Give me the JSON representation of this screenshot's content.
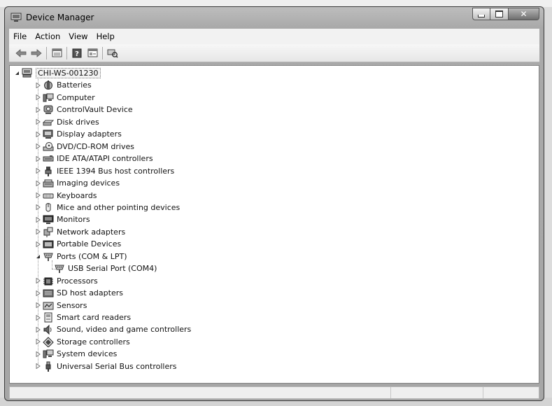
{
  "window": {
    "title": "Device Manager"
  },
  "menu": [
    "File",
    "Action",
    "View",
    "Help"
  ],
  "toolbar": [
    "back-arrow-icon",
    "forward-arrow-icon",
    "properties-icon",
    "help-icon",
    "console-tree-icon",
    "scan-hardware-icon"
  ],
  "tree": {
    "root": "CHI-WS-001230",
    "categories": [
      {
        "label": "Batteries",
        "icon": "battery-icon",
        "expanded": false
      },
      {
        "label": "Computer",
        "icon": "computer-icon",
        "expanded": false
      },
      {
        "label": "ControlVault Device",
        "icon": "controlvault-device-icon",
        "expanded": false
      },
      {
        "label": "Disk drives",
        "icon": "disk-drive-icon",
        "expanded": false
      },
      {
        "label": "Display adapters",
        "icon": "display-adapter-icon",
        "expanded": false
      },
      {
        "label": "DVD/CD-ROM drives",
        "icon": "dvd-drive-icon",
        "expanded": false
      },
      {
        "label": "IDE ATA/ATAPI controllers",
        "icon": "ide-controller-icon",
        "expanded": false
      },
      {
        "label": "IEEE 1394 Bus host controllers",
        "icon": "firewire-plug-icon",
        "expanded": false
      },
      {
        "label": "Imaging devices",
        "icon": "imaging-device-icon",
        "expanded": false
      },
      {
        "label": "Keyboards",
        "icon": "keyboard-icon",
        "expanded": false
      },
      {
        "label": "Mice and other pointing devices",
        "icon": "mouse-icon",
        "expanded": false
      },
      {
        "label": "Monitors",
        "icon": "monitor-icon",
        "expanded": false
      },
      {
        "label": "Network adapters",
        "icon": "network-adapter-icon",
        "expanded": false
      },
      {
        "label": "Portable Devices",
        "icon": "portable-device-icon",
        "expanded": false
      },
      {
        "label": "Ports (COM & LPT)",
        "icon": "port-connector-icon",
        "expanded": true,
        "children": [
          {
            "label": "USB Serial Port (COM4)",
            "icon": "port-connector-icon"
          }
        ]
      },
      {
        "label": "Processors",
        "icon": "processor-icon",
        "expanded": false
      },
      {
        "label": "SD host adapters",
        "icon": "sd-adapter-icon",
        "expanded": false
      },
      {
        "label": "Sensors",
        "icon": "sensor-icon",
        "expanded": false
      },
      {
        "label": "Smart card readers",
        "icon": "smart-card-reader-icon",
        "expanded": false
      },
      {
        "label": "Sound, video and game controllers",
        "icon": "speaker-icon",
        "expanded": false
      },
      {
        "label": "Storage controllers",
        "icon": "storage-controller-icon",
        "expanded": false
      },
      {
        "label": "System devices",
        "icon": "system-device-icon",
        "expanded": false
      },
      {
        "label": "Universal Serial Bus controllers",
        "icon": "usb-plug-icon",
        "expanded": false
      }
    ]
  }
}
